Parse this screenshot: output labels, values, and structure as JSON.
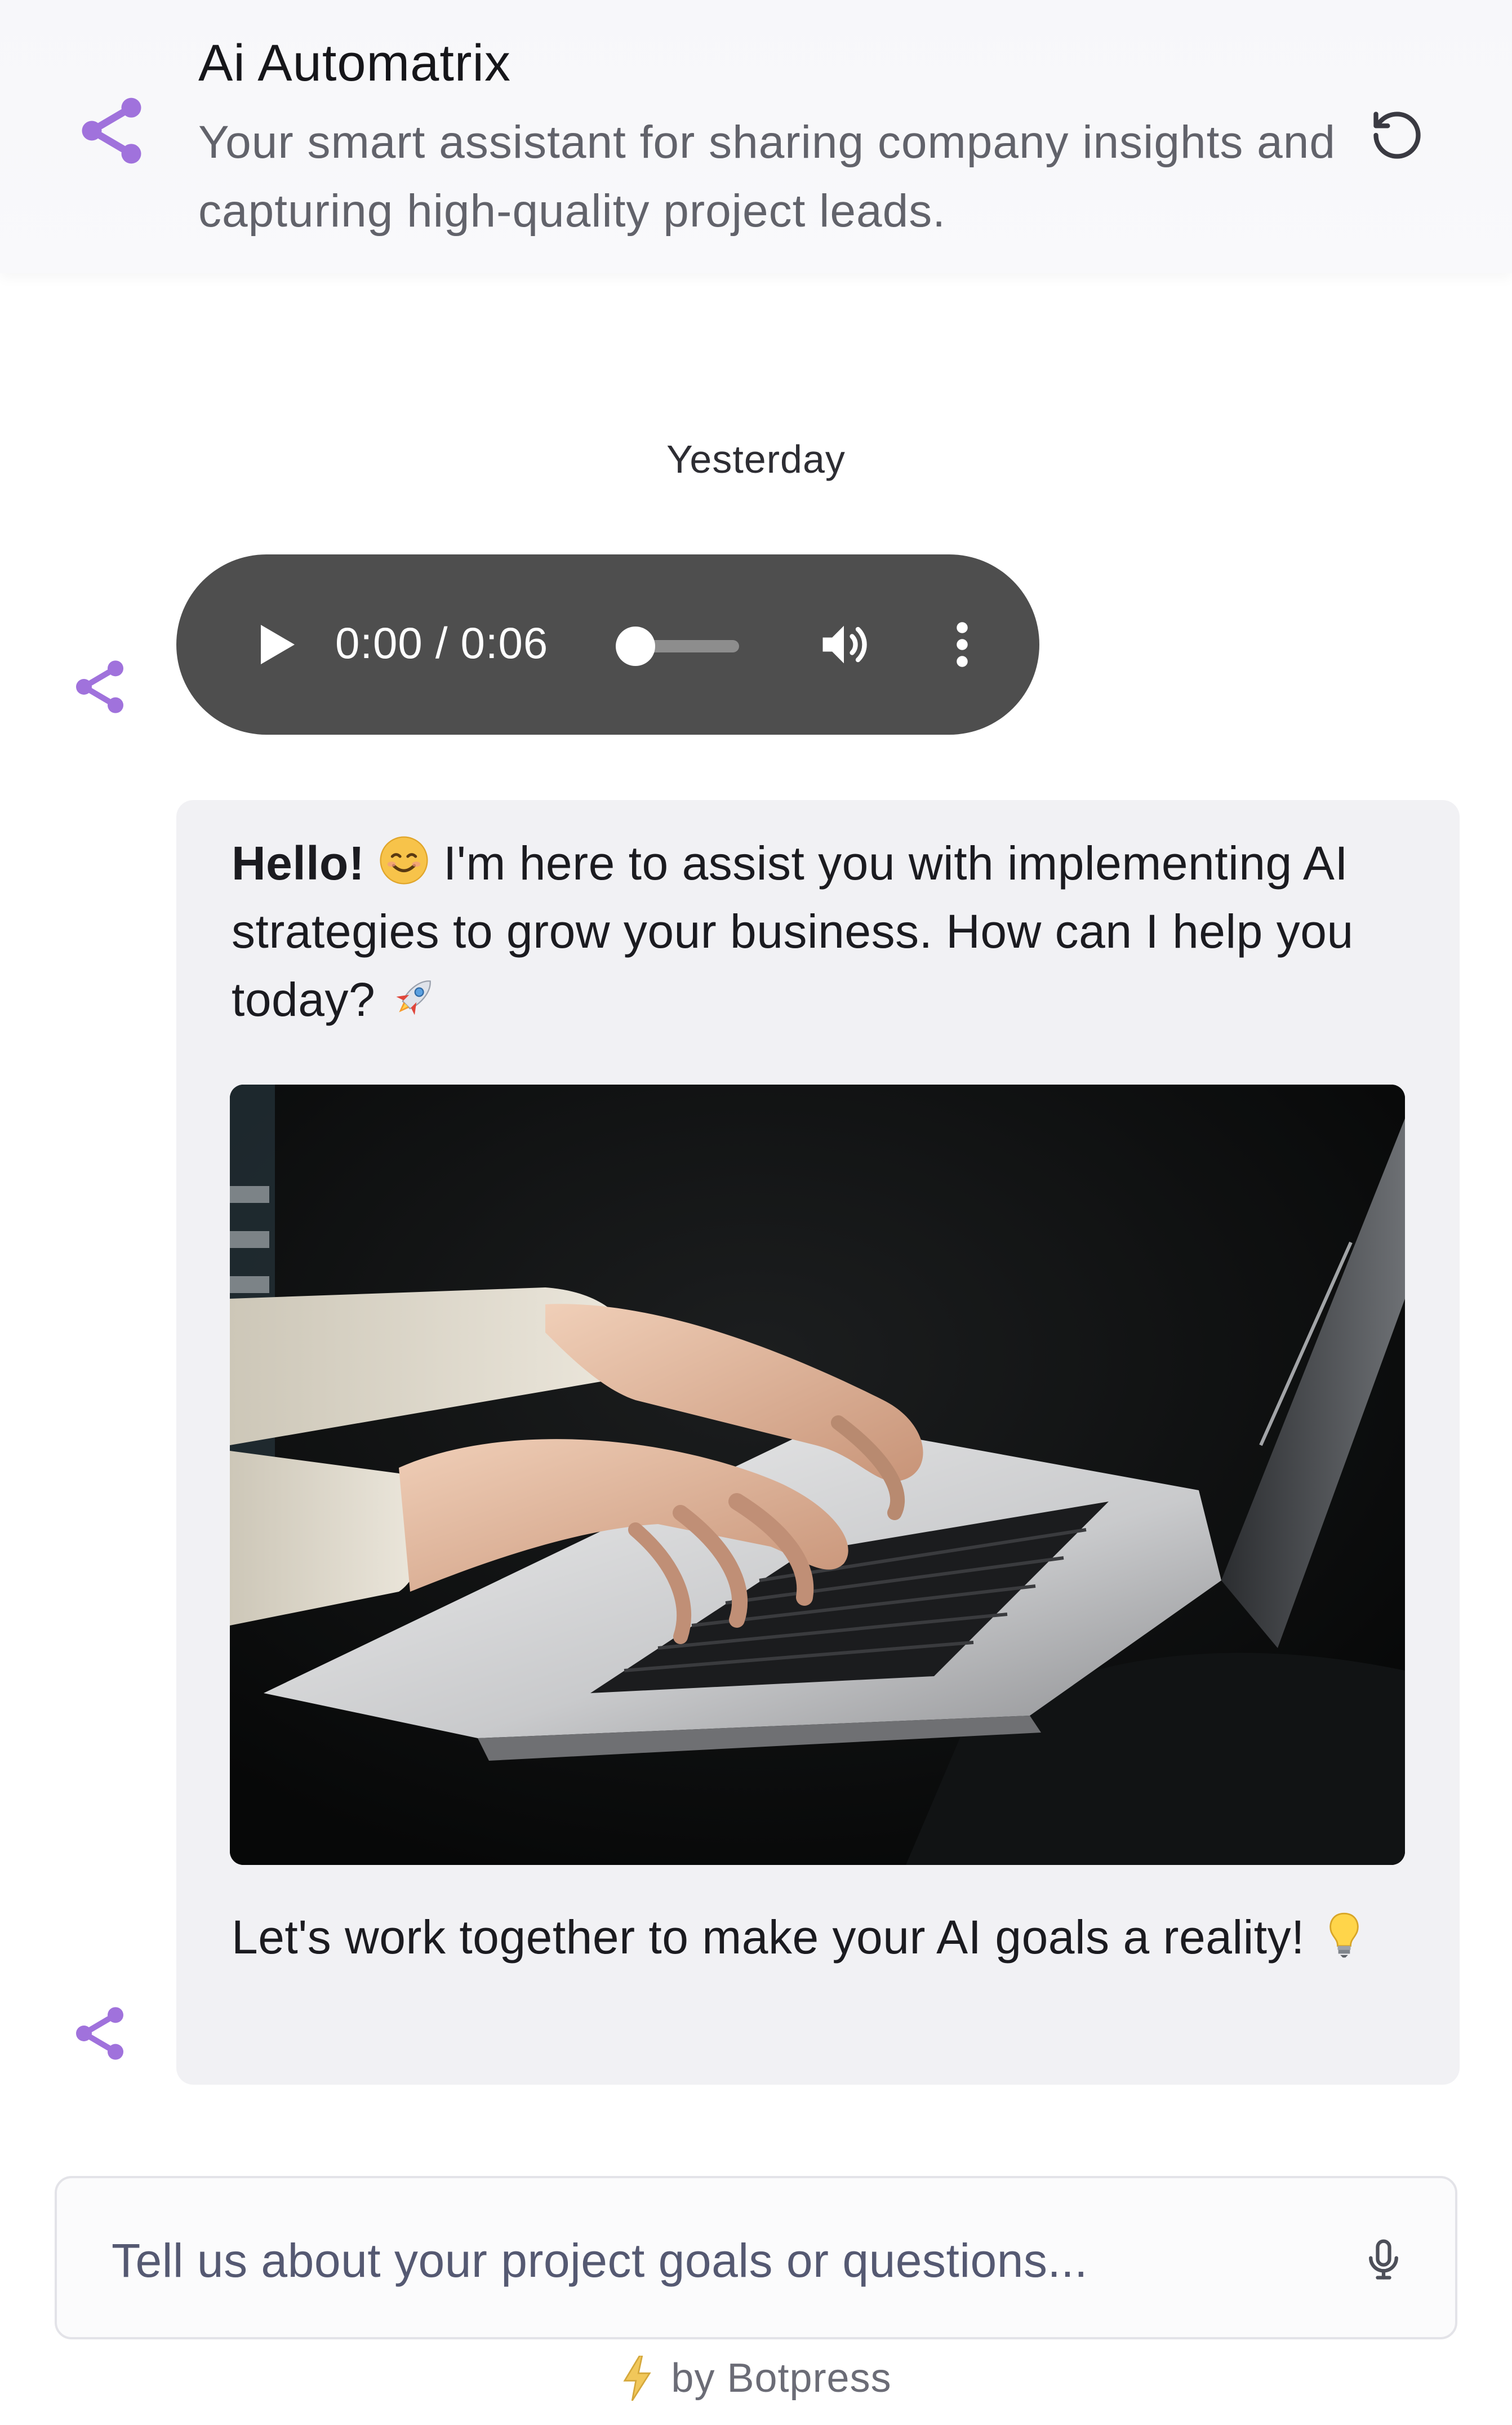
{
  "header": {
    "title": "Ai Automatrix",
    "description": "Your smart assistant for sharing company insights and capturing high-quality project leads.",
    "avatar_icon": "share-nodes-icon",
    "refresh_icon": "refresh-icon"
  },
  "conversation": {
    "date_separator": "Yesterday",
    "audio_message": {
      "current_time": "0:00",
      "separator": "/",
      "duration": "0:06",
      "progress_fraction": 0.0
    },
    "text_message": {
      "greeting_bold": "Hello!",
      "greeting_rest": "I'm here to assist you with implementing AI strategies to grow your business. How can I help you today?",
      "closing": "Let's work together to make your AI goals a reality!",
      "emojis": [
        "smiling-face-emoji",
        "rocket-emoji",
        "lightbulb-emoji"
      ]
    }
  },
  "composer": {
    "placeholder": "Tell us about your project goals or questions...",
    "value": "",
    "mic_icon": "microphone-icon"
  },
  "footer": {
    "label": "by Botpress",
    "icon": "lightning-icon"
  },
  "colors": {
    "accent": "#a072dc",
    "audio_bg": "#4e4e4e",
    "bubble_bg": "#f1f1f4",
    "header_bg": "#f7f7fa"
  }
}
